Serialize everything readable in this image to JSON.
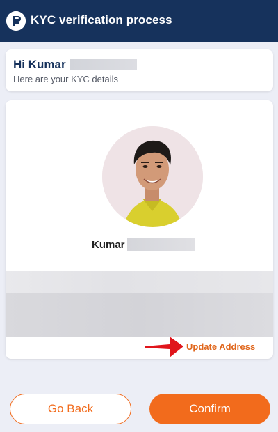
{
  "header": {
    "title": "KYC verification process",
    "logo_icon": "brand-logo-icon"
  },
  "greeting": {
    "name": "Hi Kumar",
    "subtitle": "Here are your KYC details"
  },
  "profile": {
    "first_name": "Kumar",
    "avatar_icon": "profile-photo"
  },
  "address": {
    "update_label": "Update Address"
  },
  "actions": {
    "back_label": "Go Back",
    "confirm_label": "Confirm"
  },
  "colors": {
    "header_bg": "#16325c",
    "accent": "#f26b1c",
    "page_bg": "#eceef6"
  }
}
